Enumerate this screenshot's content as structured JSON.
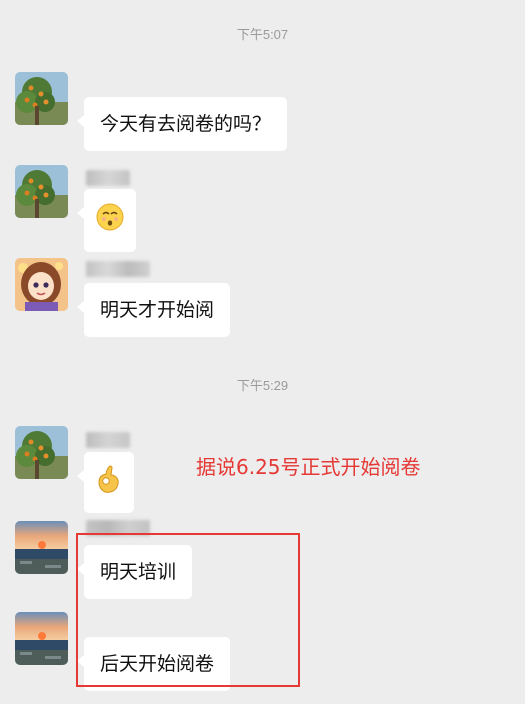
{
  "timestamps": [
    "下午5:07",
    "下午5:29"
  ],
  "messages": [
    {
      "text": "今天有去阅卷的吗？",
      "avatar": "orange-tree-avatar"
    },
    {
      "emoji_icon": "grimacing-face-icon",
      "avatar": "orange-tree-avatar"
    },
    {
      "text": "明天才开始阅",
      "avatar": "cartoon-girl-avatar"
    },
    {
      "emoji_icon": "ok-hand-icon",
      "avatar": "orange-tree-avatar"
    },
    {
      "text": "明天培训",
      "avatar": "sunset-beach-avatar"
    },
    {
      "text": "后天开始阅卷",
      "avatar": "sunset-beach-avatar"
    }
  ],
  "annotation": "据说6.25号正式开始阅卷",
  "colors": {
    "background": "#ededed",
    "bubble": "#ffffff",
    "annotation": "#e53935",
    "timestamp": "#9a9a9a"
  }
}
